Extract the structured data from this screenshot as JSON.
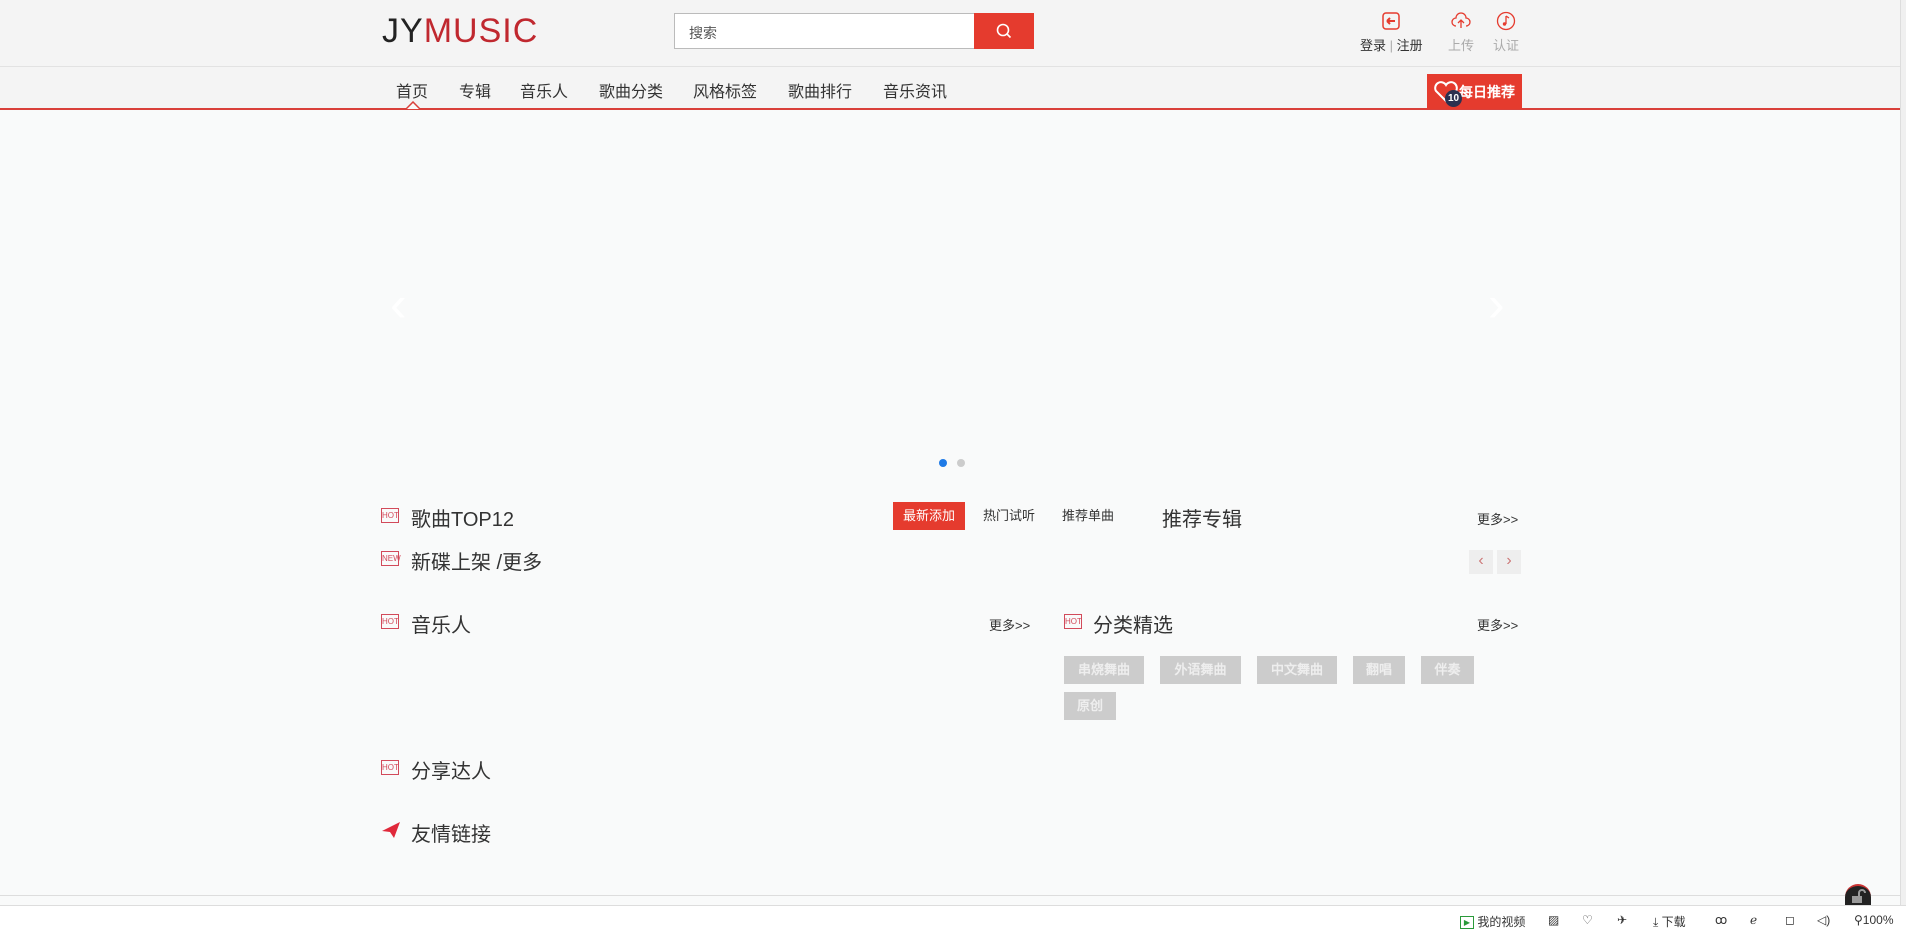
{
  "header": {
    "logo_left": "JY",
    "logo_right": "MUSIC",
    "search_placeholder": "搜索",
    "login": "登录",
    "register": "注册",
    "upload": "上传",
    "certify": "认证"
  },
  "nav": {
    "items": [
      "首页",
      "专辑",
      "音乐人",
      "歌曲分类",
      "风格标签",
      "歌曲排行",
      "音乐资讯"
    ],
    "daily_label": "每日推荐",
    "daily_count": "10"
  },
  "sections": {
    "top12": {
      "title": "歌曲TOP12",
      "tabs": [
        "最新添加",
        "热门试听",
        "推荐单曲"
      ]
    },
    "albums": {
      "title": "推荐专辑",
      "more": "更多>>"
    },
    "new_discs": {
      "title": "新碟上架 /更多"
    },
    "artists": {
      "title": "音乐人",
      "more": "更多>>"
    },
    "categories": {
      "title": "分类精选",
      "more": "更多>>",
      "tags": [
        "串烧舞曲",
        "外语舞曲",
        "中文舞曲",
        "翻唱",
        "伴奏",
        "原创"
      ]
    },
    "sharers": {
      "title": "分享达人"
    },
    "links": {
      "title": "友情链接"
    }
  },
  "badges": {
    "hot": "HOT",
    "new": "NEW"
  },
  "statusbar": {
    "video": "我的视频",
    "download": "下载",
    "zoom": "100%"
  },
  "colors": {
    "accent": "#e53b2e"
  }
}
